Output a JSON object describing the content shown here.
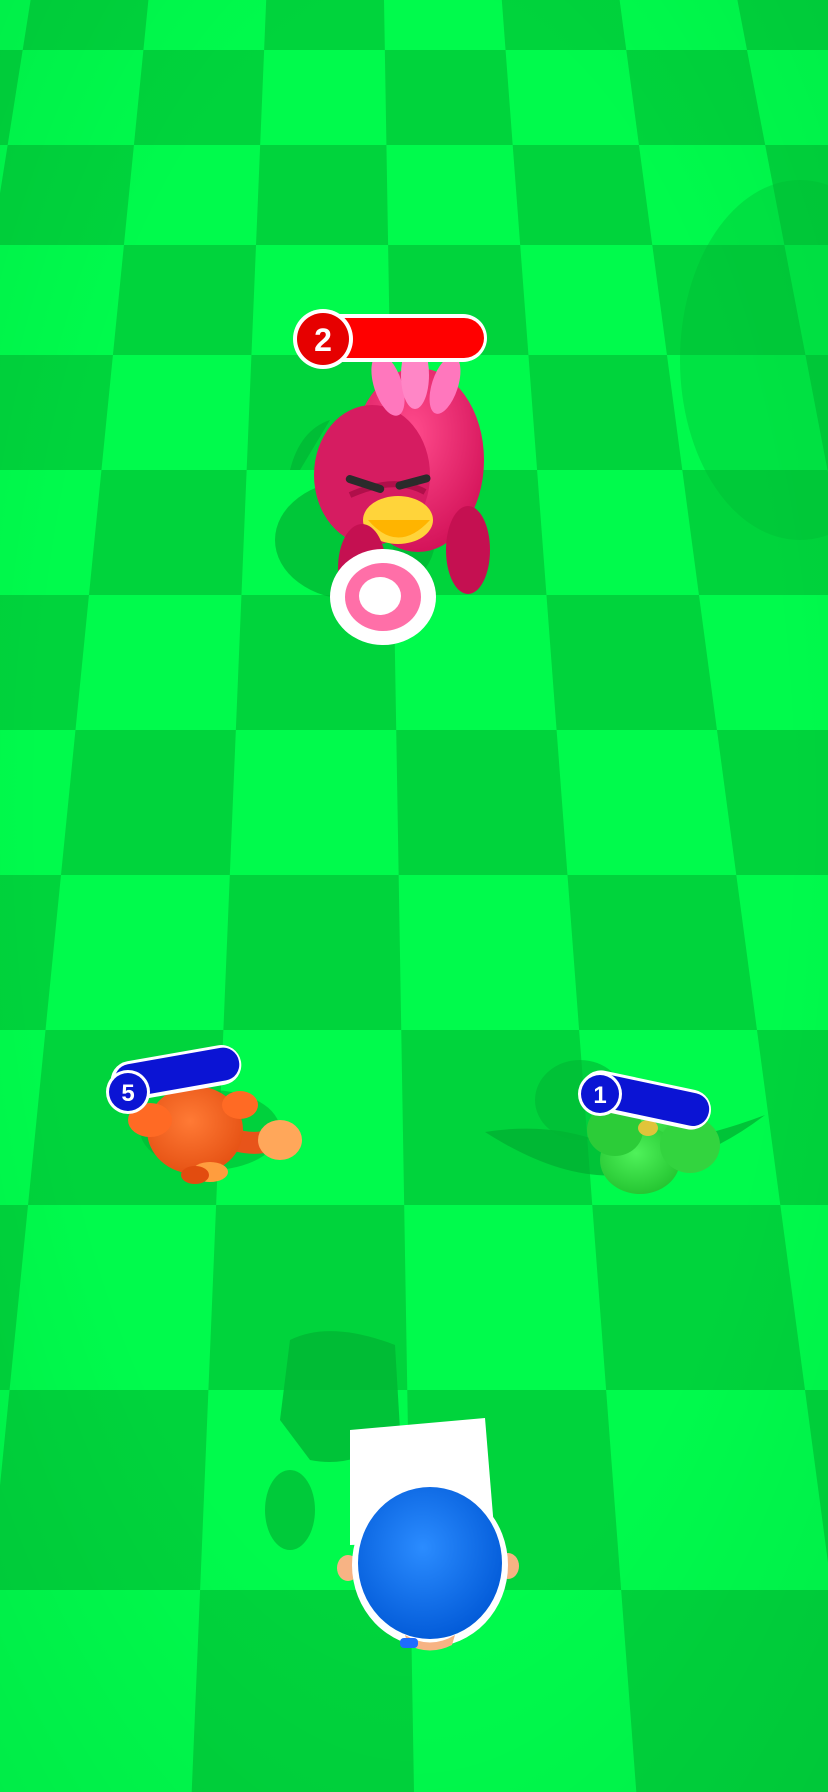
{
  "game": {
    "colors": {
      "field_light": "#00fb4c",
      "field_dark": "#00d43c",
      "enemy_bar": "#ff0000",
      "ally_bar": "#0b14d4"
    },
    "boss": {
      "name": "pink-bird-enemy",
      "level": "2"
    },
    "units": [
      {
        "name": "orange-monkey",
        "level": "5"
      },
      {
        "name": "green-bush-creature",
        "level": "1"
      }
    ],
    "player": {
      "name": "player-blue-cap"
    }
  }
}
